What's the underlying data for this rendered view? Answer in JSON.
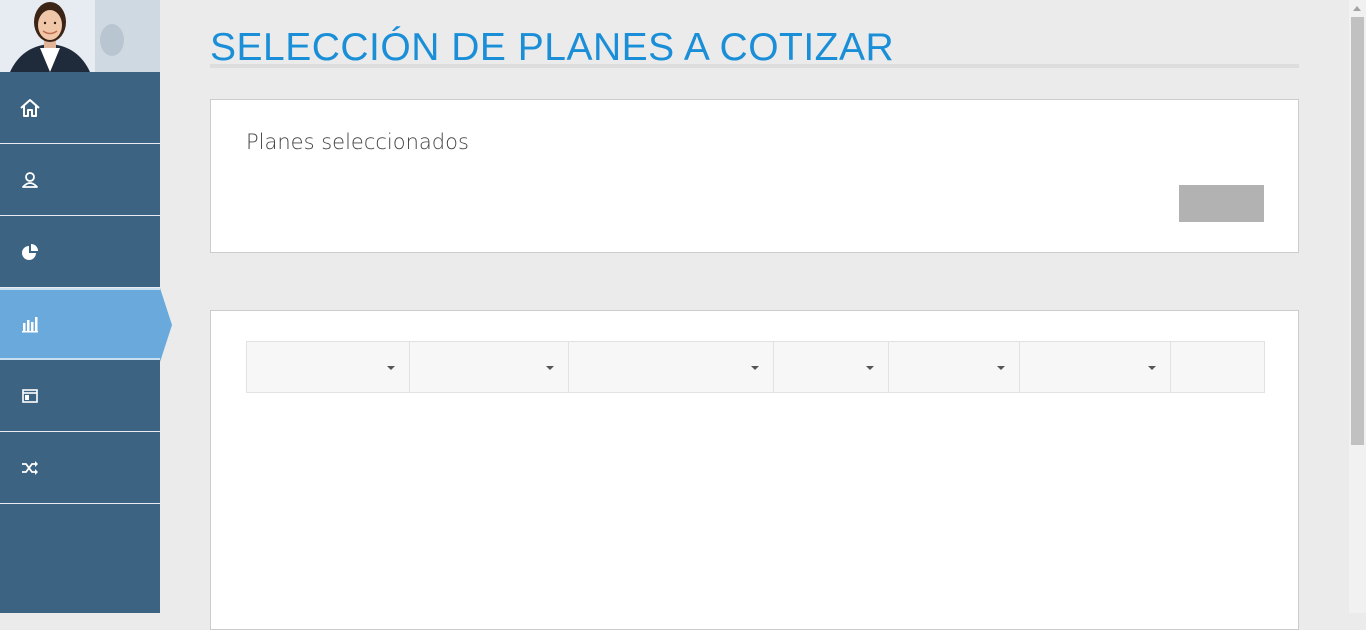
{
  "page": {
    "title": "SELECCIÓN DE PLANES A COTIZAR"
  },
  "sidebar": {
    "avatar": "profile-photo",
    "items": [
      {
        "icon": "home-icon",
        "active": false
      },
      {
        "icon": "user-icon",
        "active": false
      },
      {
        "icon": "pie-chart-icon",
        "active": false
      },
      {
        "icon": "bar-chart-icon",
        "active": true
      },
      {
        "icon": "browser-window-icon",
        "active": false
      },
      {
        "icon": "shuffle-icon",
        "active": false
      }
    ]
  },
  "selected_plans_panel": {
    "heading": "Planes seleccionados",
    "button_label": ""
  },
  "plans_table": {
    "columns": [
      "",
      "",
      "",
      "",
      "",
      "",
      ""
    ],
    "sortable": [
      true,
      true,
      true,
      true,
      true,
      true,
      false
    ]
  },
  "colors": {
    "sidebar": "#3d6383",
    "sidebar_active": "#6aa9db",
    "title": "#1a8fd8",
    "background": "#ebebeb",
    "button": "#b2b2b2"
  }
}
